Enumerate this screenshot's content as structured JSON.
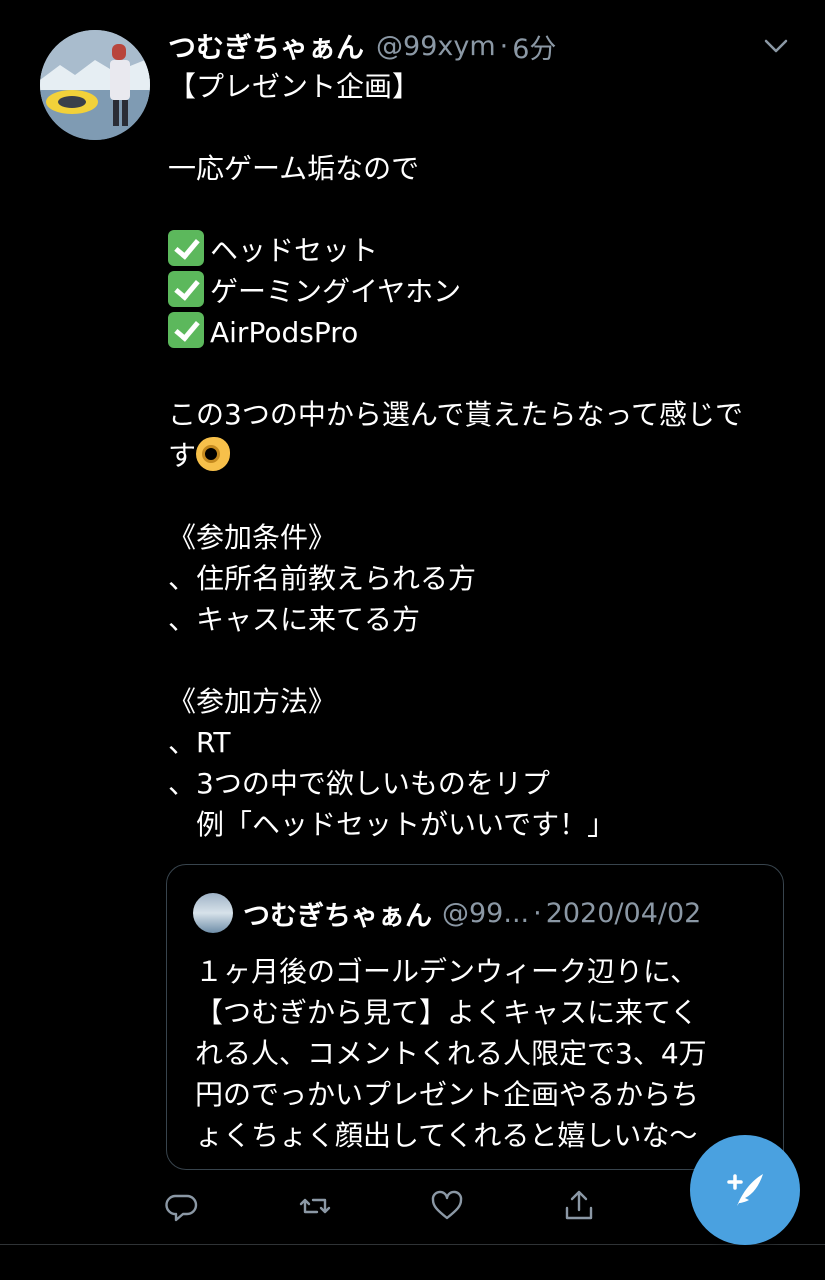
{
  "tweet": {
    "display_name": "つむぎちゃぁん",
    "handle": "@99xym",
    "separator": "·",
    "time": "6分",
    "lines": [
      "【プレゼント企画】",
      "",
      "一応ゲーム垢なので",
      "",
      "ヘッドセット",
      "ゲーミングイヤホン",
      "AirPodsPro",
      "",
      "この3つの中から選んで貰えたらなって感じで",
      "す",
      "",
      "《参加条件》",
      "、住所名前教えられる方",
      "、キャスに来てる方",
      "",
      "《参加方法》",
      "、RT",
      "、3つの中で欲しいものをリプ",
      "　例「ヘッドセットがいいです！」"
    ]
  },
  "quote": {
    "display_name": "つむぎちゃぁん",
    "handle": "@99...",
    "separator": "·",
    "date": "2020/04/02",
    "lines": [
      "１ヶ月後のゴールデンウィーク辺りに、",
      "【つむぎから見て】よくキャスに来てく",
      "れる人、コメントくれる人限定で3、4万",
      "円のでっかいプレゼント企画やるからち",
      "ょくちょく顔出してくれると嬉しいな〜"
    ]
  },
  "icons": {
    "reply": "reply-icon",
    "retweet": "retweet-icon",
    "like": "heart-icon",
    "share": "share-icon",
    "compose": "compose-tweet-icon",
    "more": "chevron-down-icon"
  },
  "colors": {
    "background": "#000000",
    "secondary_text": "#8b98a5",
    "accent": "#4aa1e0",
    "border": "#38444d"
  }
}
